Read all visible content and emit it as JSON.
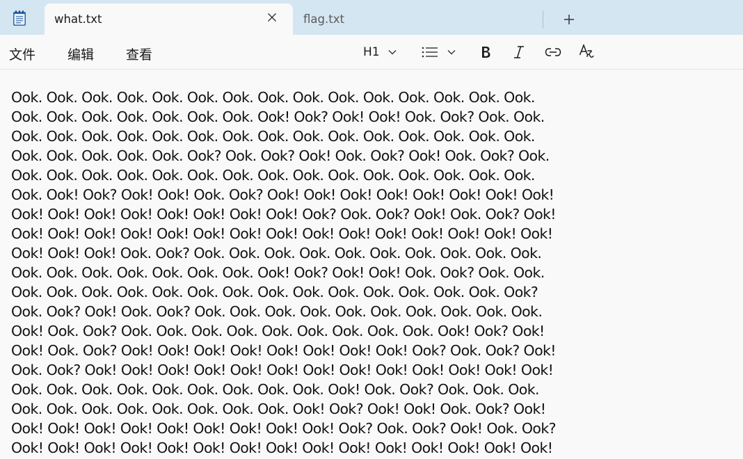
{
  "tabs": [
    {
      "title": "what.txt",
      "active": true
    },
    {
      "title": "flag.txt",
      "active": false
    }
  ],
  "menu": [
    "文件",
    "编辑",
    "查看"
  ],
  "toolbar": {
    "heading_label": "H1",
    "icons": [
      "heading-dropdown",
      "list-icon",
      "bold-icon",
      "italic-icon",
      "link-icon",
      "clear-formatting-icon"
    ]
  },
  "colors": {
    "titlebar": "#d4e6f1",
    "editor_bg": "#f9f9f9",
    "text": "#111111"
  },
  "editor": {
    "content": "Ook. Ook. Ook. Ook. Ook. Ook. Ook. Ook. Ook. Ook. Ook. Ook. Ook. Ook. Ook.\nOok. Ook. Ook. Ook. Ook. Ook. Ook. Ook! Ook? Ook! Ook! Ook. Ook? Ook. Ook.\nOok. Ook. Ook. Ook. Ook. Ook. Ook. Ook. Ook. Ook. Ook. Ook. Ook. Ook. Ook.\nOok. Ook. Ook. Ook. Ook. Ook? Ook. Ook? Ook! Ook. Ook? Ook! Ook. Ook? Ook.\nOok. Ook. Ook. Ook. Ook. Ook. Ook. Ook. Ook. Ook. Ook. Ook. Ook. Ook. Ook.\nOok. Ook! Ook? Ook! Ook! Ook. Ook? Ook! Ook! Ook! Ook! Ook! Ook! Ook! Ook!\nOok! Ook! Ook! Ook! Ook! Ook! Ook! Ook! Ook? Ook. Ook? Ook! Ook. Ook? Ook!\nOok! Ook! Ook! Ook! Ook! Ook! Ook! Ook! Ook! Ook! Ook! Ook! Ook! Ook! Ook!\nOok! Ook! Ook! Ook. Ook? Ook. Ook. Ook. Ook. Ook. Ook. Ook. Ook. Ook. Ook.\nOok. Ook. Ook. Ook. Ook. Ook. Ook. Ook! Ook? Ook! Ook! Ook. Ook? Ook. Ook.\nOok. Ook. Ook. Ook. Ook. Ook. Ook. Ook. Ook. Ook. Ook. Ook. Ook. Ook. Ook?\nOok. Ook? Ook! Ook. Ook? Ook. Ook. Ook. Ook. Ook. Ook. Ook. Ook. Ook. Ook.\nOok! Ook. Ook? Ook. Ook. Ook. Ook. Ook. Ook. Ook. Ook. Ook. Ook! Ook? Ook!\nOok! Ook. Ook? Ook! Ook! Ook! Ook! Ook! Ook! Ook! Ook! Ook? Ook. Ook? Ook!\nOok. Ook? Ook! Ook! Ook! Ook! Ook! Ook! Ook! Ook! Ook! Ook! Ook! Ook! Ook!\nOok. Ook. Ook. Ook. Ook. Ook. Ook. Ook. Ook. Ook! Ook. Ook? Ook. Ook. Ook.\nOok. Ook. Ook. Ook. Ook. Ook. Ook. Ook. Ook! Ook? Ook! Ook! Ook. Ook? Ook!\nOok! Ook! Ook! Ook! Ook! Ook! Ook! Ook! Ook! Ook? Ook. Ook? Ook! Ook. Ook?\nOok! Ook! Ook! Ook! Ook! Ook! Ook! Ook! Ook! Ook! Ook! Ook! Ook! Ook! Ook!"
  }
}
